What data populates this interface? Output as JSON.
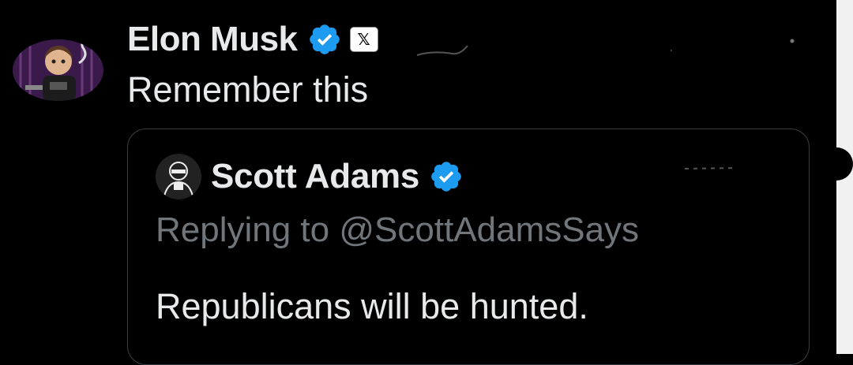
{
  "post": {
    "author_name": "Elon Musk",
    "affiliate_badge": "𝕏",
    "text": "Remember this"
  },
  "quoted_post": {
    "author_name": "Scott Adams",
    "reply_prefix": "Replying to ",
    "reply_handle": "@ScottAdamsSays",
    "text": "Republicans will be hunted."
  },
  "colors": {
    "background": "#000000",
    "text_primary": "#e7e9ea",
    "text_secondary": "#71767b",
    "verified_blue": "#1d9bf0",
    "card_border": "#3a3d40"
  },
  "icons": {
    "verified": "verified-badge-icon",
    "affiliate": "x-logo-icon"
  }
}
